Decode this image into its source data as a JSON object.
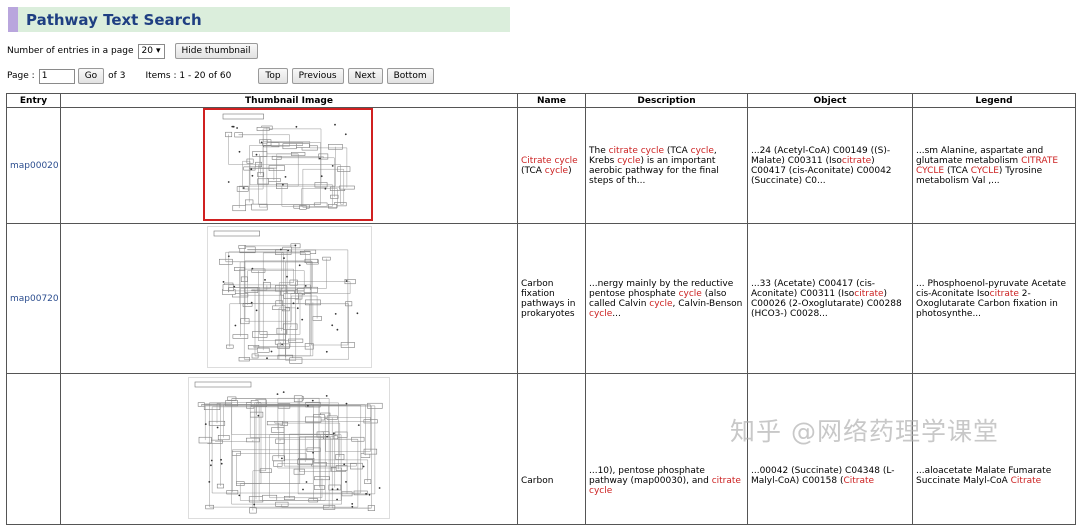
{
  "page_title": "Pathway Text Search",
  "controls": {
    "entries_label": "Number of entries in a page",
    "entries_value": "20",
    "hide_thumbnail": "Hide thumbnail",
    "page_label": "Page :",
    "page_value": "1",
    "go": "Go",
    "of_pages": "of 3",
    "items_info": "Items : 1 - 20 of 60",
    "top": "Top",
    "previous": "Previous",
    "next": "Next",
    "bottom": "Bottom"
  },
  "table": {
    "headers": [
      "Entry",
      "Thumbnail Image",
      "Name",
      "Description",
      "Object",
      "Legend"
    ],
    "rows": [
      {
        "entry": "map00020",
        "name": [
          [
            "Citrate cycle",
            "hl"
          ],
          [
            " (TCA ",
            ""
          ],
          [
            "cycle",
            "hl"
          ],
          [
            ")",
            ""
          ]
        ],
        "description": [
          [
            "The ",
            ""
          ],
          [
            "citrate cycle",
            "hl"
          ],
          [
            " (TCA ",
            ""
          ],
          [
            "cycle",
            "hl"
          ],
          [
            ", Krebs ",
            ""
          ],
          [
            "cycle",
            "hl"
          ],
          [
            ") is an important aerobic pathway for the final steps of th...",
            ""
          ]
        ],
        "object": [
          [
            "...24 (Acetyl-CoA) C00149 ((S)-Malate) C00311 (Iso",
            ""
          ],
          [
            "citrate",
            "hl"
          ],
          [
            ") C00417 (cis-Aconitate) C00042 (Succinate) C0...",
            ""
          ]
        ],
        "legend": [
          [
            "...sm Alanine, aspartate and glutamate metabolism ",
            ""
          ],
          [
            "CITRATE CYCLE",
            "hl"
          ],
          [
            " (TCA ",
            ""
          ],
          [
            "CYCLE",
            "hl"
          ],
          [
            ") Tyrosine metabolism Val ,...",
            ""
          ]
        ]
      },
      {
        "entry": "map00720",
        "name": [
          [
            "Carbon fixation pathways in prokaryotes",
            ""
          ]
        ],
        "description": [
          [
            "...nergy mainly by the reductive pentose phosphate ",
            ""
          ],
          [
            "cycle",
            "hl"
          ],
          [
            " (also called Calvin ",
            ""
          ],
          [
            "cycle",
            "hl"
          ],
          [
            ", Calvin-Benson ",
            ""
          ],
          [
            "cycle",
            "hl"
          ],
          [
            "...",
            ""
          ]
        ],
        "object": [
          [
            "...33 (Acetate) C00417 (cis-Aconitate) C00311 (Iso",
            ""
          ],
          [
            "citrate",
            "hl"
          ],
          [
            ") C00026 (2-Oxoglutarate) C00288 (HCO3-) C0028...",
            ""
          ]
        ],
        "legend": [
          [
            "... Phosphoenol-pyruvate Acetate cis-Aconitate Iso",
            ""
          ],
          [
            "citrate",
            "hl"
          ],
          [
            " 2-Oxoglutarate Carbon fixation in photosynthe...",
            ""
          ]
        ]
      },
      {
        "entry": "",
        "name": [
          [
            "Carbon",
            ""
          ]
        ],
        "description": [
          [
            "...10), pentose phosphate pathway (map00030), and ",
            ""
          ],
          [
            "citrate cycle",
            "hl"
          ]
        ],
        "object": [
          [
            "...00042 (Succinate) C04348 (L-Malyl-CoA) C00158 (",
            ""
          ],
          [
            "Citrate",
            "hl"
          ]
        ],
        "legend": [
          [
            "...aloacetate Malate Fumarate Succinate Malyl-CoA ",
            ""
          ],
          [
            "Citrate",
            "hl"
          ]
        ]
      }
    ]
  },
  "watermark": "知乎 @网络药理学课堂"
}
